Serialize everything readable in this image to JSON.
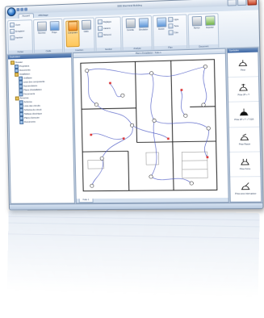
{
  "window": {
    "title": "SEE Electrical Building"
  },
  "tabs": [
    {
      "label": "Accueil",
      "active": true
    },
    {
      "label": "Affichage",
      "active": false
    }
  ],
  "ribbon": {
    "groups": [
      {
        "label": "Fichier",
        "small": [
          "Ouvrir",
          "Enregistrer",
          "Imprimer"
        ]
      },
      {
        "label": "Outils",
        "big": [
          {
            "label": "Nouveau",
            "icon": "new-icon"
          },
          {
            "label": "Projet",
            "icon": "project-icon"
          }
        ]
      },
      {
        "label": "Insertion",
        "big": [
          {
            "label": "Composant",
            "icon": "component-icon",
            "selected": true
          },
          {
            "label": "Câble",
            "icon": "cable-icon"
          }
        ]
      },
      {
        "label": "Gestion",
        "small": [
          "Réglages",
          "Liaisons",
          "Nomencl."
        ]
      },
      {
        "label": "Analyse",
        "big": [
          {
            "label": "Contrôle",
            "icon": "check-icon"
          },
          {
            "label": "Simulation",
            "icon": "simulation-icon"
          }
        ]
      },
      {
        "label": "Plan",
        "big": [
          {
            "label": "Dessin",
            "icon": "draw-icon"
          }
        ],
        "small": [
          "Ligne",
          "Texte",
          "Cote"
        ]
      },
      {
        "label": "Document",
        "big": [
          {
            "label": "Aperçu",
            "icon": "preview-icon"
          },
          {
            "label": "Exporter",
            "icon": "export-icon"
          }
        ]
      }
    ]
  },
  "tree": {
    "header": "Explorateur",
    "items": [
      {
        "label": "Dossier",
        "level": 0,
        "kind": "folder"
      },
      {
        "label": "Propriétés",
        "level": 1,
        "kind": "doc"
      },
      {
        "label": "Documents",
        "level": 1,
        "kind": "doc"
      },
      {
        "label": "Installation",
        "level": 1,
        "kind": "folder"
      },
      {
        "label": "Unifilaire",
        "level": 2,
        "kind": "doc"
      },
      {
        "label": "Liste des composants",
        "level": 2,
        "kind": "doc"
      },
      {
        "label": "Nomenclature",
        "level": 2,
        "kind": "doc"
      },
      {
        "label": "Plans d'installation",
        "level": 2,
        "kind": "doc"
      },
      {
        "label": "Documents",
        "level": 2,
        "kind": "doc"
      },
      {
        "label": "Armoires",
        "level": 1,
        "kind": "folder"
      },
      {
        "label": "Schéma",
        "level": 2,
        "kind": "doc"
      },
      {
        "label": "Liste des circuits",
        "level": 2,
        "kind": "doc"
      },
      {
        "label": "Schéma de circuit",
        "level": 2,
        "kind": "doc"
      },
      {
        "label": "Tableau électrique",
        "level": 2,
        "kind": "doc"
      },
      {
        "label": "Plans d'armoire",
        "level": 2,
        "kind": "doc"
      },
      {
        "label": "Documents",
        "level": 2,
        "kind": "doc"
      }
    ]
  },
  "canvas": {
    "title": "Plans d'installation - Folio 1",
    "tab": "Folio 1"
  },
  "symbols": {
    "header": "Symboles",
    "items": [
      {
        "label": "Prise",
        "icon": "socket-icon"
      },
      {
        "label": "Prise 2P + T",
        "icon": "socket-earth-icon"
      },
      {
        "label": "Prise 2P + T + T 32A",
        "icon": "socket-power-icon"
      },
      {
        "label": "Prise Rasoir",
        "icon": "shaver-socket-icon"
      },
      {
        "label": "Prise Force",
        "icon": "power-socket-icon"
      },
      {
        "label": "Prise avec interrupteur",
        "icon": "switched-socket-icon"
      }
    ]
  }
}
